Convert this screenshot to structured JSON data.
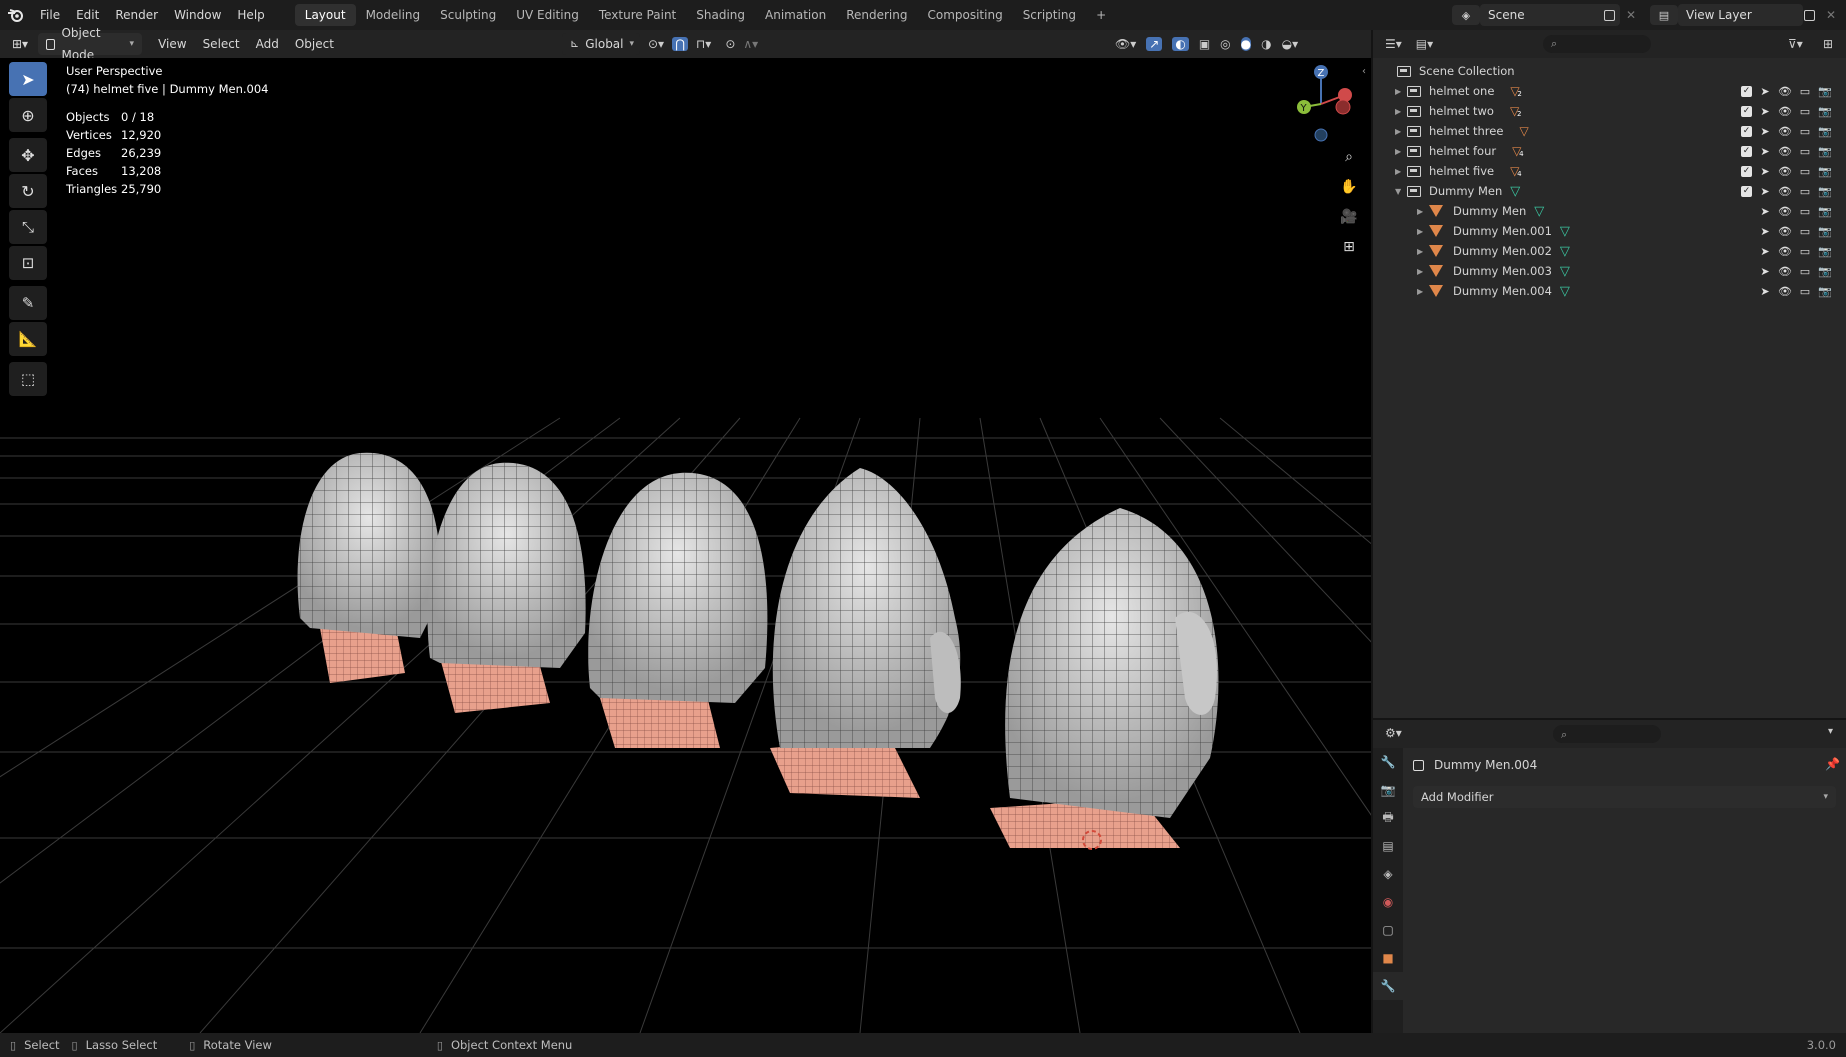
{
  "topbar": {
    "menus": [
      "File",
      "Edit",
      "Render",
      "Window",
      "Help"
    ],
    "workspaces": [
      {
        "label": "Layout",
        "active": true
      },
      {
        "label": "Modeling",
        "active": false
      },
      {
        "label": "Sculpting",
        "active": false
      },
      {
        "label": "UV Editing",
        "active": false
      },
      {
        "label": "Texture Paint",
        "active": false
      },
      {
        "label": "Shading",
        "active": false
      },
      {
        "label": "Animation",
        "active": false
      },
      {
        "label": "Rendering",
        "active": false
      },
      {
        "label": "Compositing",
        "active": false
      },
      {
        "label": "Scripting",
        "active": false
      }
    ],
    "add_tab": "+",
    "scene": "Scene",
    "view_layer": "View Layer"
  },
  "viewport_header": {
    "mode": "Object Mode",
    "menus": [
      "View",
      "Select",
      "Add",
      "Object"
    ],
    "orientation": "Global"
  },
  "viewport": {
    "view_name": "User Perspective",
    "context": "(74) helmet five | Dummy Men.004",
    "stats": [
      {
        "key": "Objects",
        "value": "0 / 18"
      },
      {
        "key": "Vertices",
        "value": "12,920"
      },
      {
        "key": "Edges",
        "value": "26,239"
      },
      {
        "key": "Faces",
        "value": "13,208"
      },
      {
        "key": "Triangles",
        "value": "25,790"
      }
    ],
    "gizmo": {
      "z": "Z",
      "y": "Y"
    }
  },
  "outliner": {
    "root": "Scene Collection",
    "rows": [
      {
        "label": "helmet one",
        "kind": "collection",
        "expanded": false,
        "child_count": "2"
      },
      {
        "label": "helmet two",
        "kind": "collection",
        "expanded": false,
        "child_count": "2"
      },
      {
        "label": "helmet three",
        "kind": "collection",
        "expanded": false,
        "child_count": ""
      },
      {
        "label": "helmet four",
        "kind": "collection",
        "expanded": false,
        "child_count": "4"
      },
      {
        "label": "helmet five",
        "kind": "collection",
        "expanded": false,
        "child_count": "4"
      },
      {
        "label": "Dummy Men",
        "kind": "collection",
        "expanded": true,
        "child_count": ""
      },
      {
        "label": "Dummy Men",
        "kind": "object",
        "expanded": false,
        "child_count": ""
      },
      {
        "label": "Dummy Men.001",
        "kind": "object",
        "expanded": false,
        "child_count": ""
      },
      {
        "label": "Dummy Men.002",
        "kind": "object",
        "expanded": false,
        "child_count": ""
      },
      {
        "label": "Dummy Men.003",
        "kind": "object",
        "expanded": false,
        "child_count": ""
      },
      {
        "label": "Dummy Men.004",
        "kind": "object",
        "expanded": false,
        "child_count": ""
      }
    ]
  },
  "properties": {
    "object_name": "Dummy Men.004",
    "add_modifier": "Add Modifier"
  },
  "statusbar": {
    "items": [
      "Select",
      "Lasso Select",
      "Rotate View",
      "Object Context Menu"
    ],
    "version": "3.0.0"
  },
  "colors": {
    "accent": "#4772b3",
    "object_orange": "#e0874a",
    "mesh_green": "#3bc6a1",
    "skin": "#e8a08c"
  }
}
